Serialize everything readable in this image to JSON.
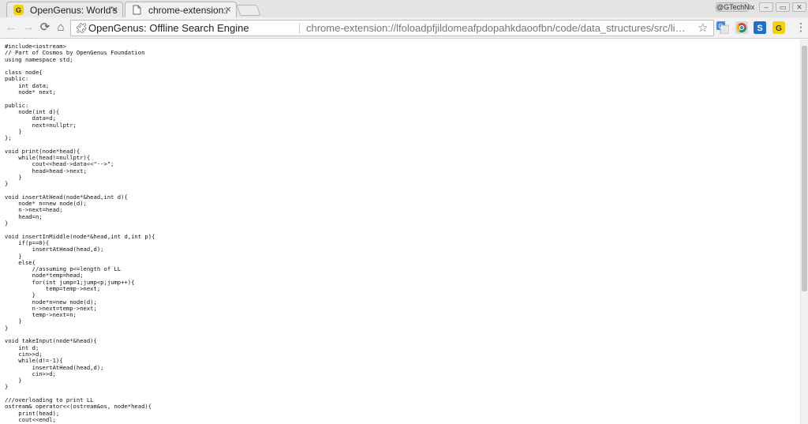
{
  "tabs": [
    {
      "title": "OpenGenus: World's f",
      "icon": "opengenus-icon",
      "close": "×",
      "active": false
    },
    {
      "title": "chrome-extension://lfi",
      "icon": "page-icon",
      "close": "×",
      "active": true
    }
  ],
  "profile_label": "@GTechNix",
  "window_controls": {
    "minimize": "–",
    "restore": "▭",
    "close": "✕"
  },
  "toolbar": {
    "back": "←",
    "forward": "→",
    "reload": "⟳",
    "home": "⌂",
    "omnibox": {
      "origin_label": "OpenGenus: Offline Search Engine",
      "url": "chrome-extension://lfoloadpfjildomeafpdopahkdaoofbn/code/data_structures/src/list/singly_linked_list/operations/..."
    },
    "menu": "⋮",
    "extensions": [
      "translate-icon",
      "chrome-web-store-icon",
      "s-extension-icon",
      "opengenus-extension-icon"
    ]
  },
  "colors": {
    "tab_bg": "#f2f2f2",
    "chrome_bg": "#e4e4e4",
    "opengenus_yellow": "#f4d400"
  },
  "code": "#include<iostream>\n// Part of Cosmos by OpenGenus Foundation\nusing namespace std;\n\nclass node{\npublic:\n    int data;\n    node* next;\n\npublic:\n    node(int d){\n        data=d;\n        next=nullptr;\n    }\n};\n\nvoid print(node*head){\n    while(head!=nullptr){\n        cout<<head->data<<\"-->\";\n        head=head->next;\n    }\n}\n\nvoid insertAtHead(node*&head,int d){\n    node* n=new node(d);\n    n->next=head;\n    head=n;\n}\n\nvoid insertInMiddle(node*&head,int d,int p){\n    if(p==0){\n        insertAtHead(head,d);\n    }\n    else{\n        //assuming p<=length of LL\n        node*temp=head;\n        for(int jump=1;jump<p;jump++){\n            temp=temp->next;\n        }\n        node*n=new node(d);\n        n->next=temp->next;\n        temp->next=n;\n    }\n}\n\nvoid takeInput(node*&head){\n    int d;\n    cin>>d;\n    while(d!=-1){\n        insertAtHead(head,d);\n        cin>>d;\n    }\n}\n\n///overloading to print LL\nostream& operator<<(ostream&os, node*head){\n    print(head);\n    cout<<endl;\n    return os;\n}"
}
